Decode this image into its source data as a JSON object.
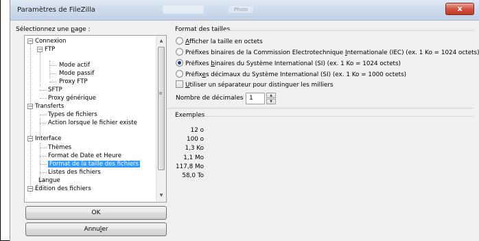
{
  "window": {
    "title": "Paramètres de FileZilla",
    "background_tab": "Photo",
    "close_glyph": "x"
  },
  "left": {
    "select_label_pre": "Sélectionnez une ",
    "select_label_ul": "p",
    "select_label_post": "age :",
    "tree": [
      {
        "label": "Connexion",
        "expander": "−"
      },
      {
        "label": "FTP",
        "expander": "−"
      },
      {
        "label": "Mode actif"
      },
      {
        "label": "Mode passif"
      },
      {
        "label": "Proxy FTP"
      },
      {
        "label": "SFTP"
      },
      {
        "label": "Proxy générique"
      },
      {
        "label": "Transferts",
        "expander": "−"
      },
      {
        "label": "Types de fichiers"
      },
      {
        "label": "Action lorsque le fichier existe"
      },
      {
        "label": "Interface",
        "expander": "−"
      },
      {
        "label": "Thèmes"
      },
      {
        "label": "Format de Date et Heure"
      },
      {
        "label": "Format de la taille des fichiers",
        "selected": true
      },
      {
        "label": "Listes des fichiers"
      },
      {
        "label": "Langue"
      },
      {
        "label": "Édition des fichiers",
        "expander": "−"
      }
    ],
    "scroll_up_glyph": "▲",
    "scroll_down_glyph": "▼",
    "scroll_grip_glyph": "≡",
    "ok_label": "OK",
    "cancel_pre": "Annu",
    "cancel_ul": "l",
    "cancel_post": "er"
  },
  "right": {
    "format_title": "Format des tailles",
    "options": [
      {
        "pre": "",
        "ul": "A",
        "post": "fficher la taille en octets",
        "checked": false
      },
      {
        "pre": "Préfixes binaires de la Commission Electrotechnique ",
        "ul": "I",
        "post": "nternationale (IEC) (ex. 1 Ko = 1024 octets)",
        "checked": false
      },
      {
        "pre": "Préfixes ",
        "ul": "b",
        "post": "inaires du Système International (SI) (ex. 1 Ko = 1024 octets)",
        "checked": true
      },
      {
        "pre": "Préfix",
        "ul": "e",
        "post": "s décimaux du Système International (SI) (ex. 1 Ko = 1000 octets)",
        "checked": false
      }
    ],
    "separator": {
      "pre": "",
      "ul": "U",
      "post": "tiliser un séparateur pour distinguer les milliers",
      "checked": false
    },
    "decimals_label": "Nombre de décimales :",
    "decimals_value": "1",
    "spin_up_glyph": "▲",
    "spin_down_glyph": "▼",
    "examples_title": "Exemples",
    "examples": [
      "12 o",
      "100 o",
      "1,3 Ko",
      "1,1 Mo",
      "117,8 Mo",
      "58,0 To"
    ]
  }
}
